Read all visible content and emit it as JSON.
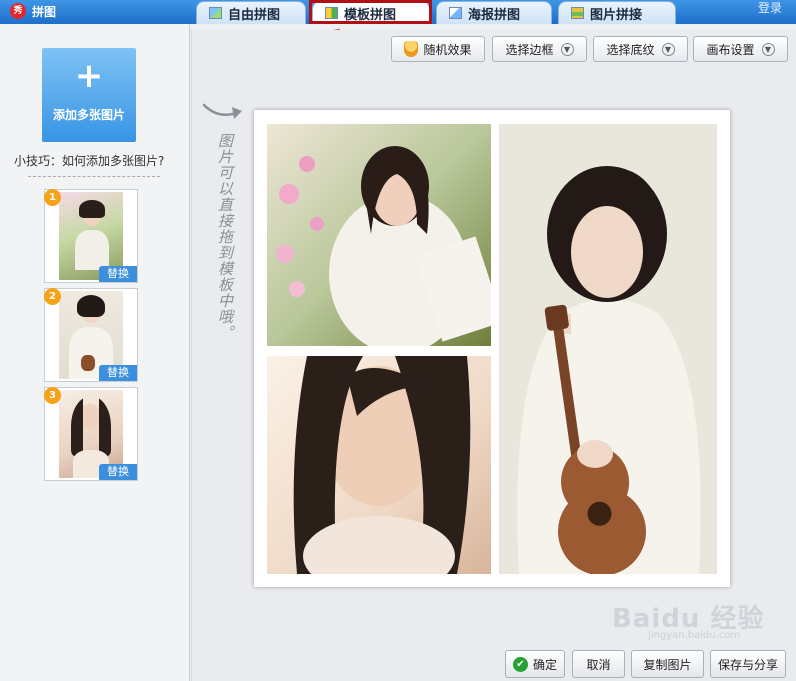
{
  "app": {
    "title": "拼图",
    "logo_text": "秀",
    "login": "登录"
  },
  "tabs": [
    {
      "label": "自由拼图",
      "icon": "free-collage-icon"
    },
    {
      "label": "模板拼图",
      "icon": "template-collage-icon",
      "active": true
    },
    {
      "label": "海报拼图",
      "icon": "poster-collage-icon"
    },
    {
      "label": "图片拼接",
      "icon": "image-join-icon"
    }
  ],
  "sidebar": {
    "add_label": "添加多张图片",
    "tip": "小技巧：如何添加多张图片?",
    "thumbs": [
      {
        "num": "1",
        "replace": "替换"
      },
      {
        "num": "2",
        "replace": "替换"
      },
      {
        "num": "3",
        "replace": "替换"
      }
    ]
  },
  "toolbar": {
    "random": "随机效果",
    "border": "选择边框",
    "background": "选择底纹",
    "canvas": "画布设置"
  },
  "hint_text": "图片可以直接拖到模板中哦。",
  "footer": {
    "confirm": "确定",
    "cancel": "取消",
    "copy": "复制图片",
    "save_share": "保存与分享"
  },
  "watermark": {
    "brand": "Baidu 经验",
    "url": "jingyan.baidu.com"
  },
  "colors": {
    "accent": "#1d6fc9",
    "highlight": "#b10f14",
    "badge": "#f6a31a"
  }
}
